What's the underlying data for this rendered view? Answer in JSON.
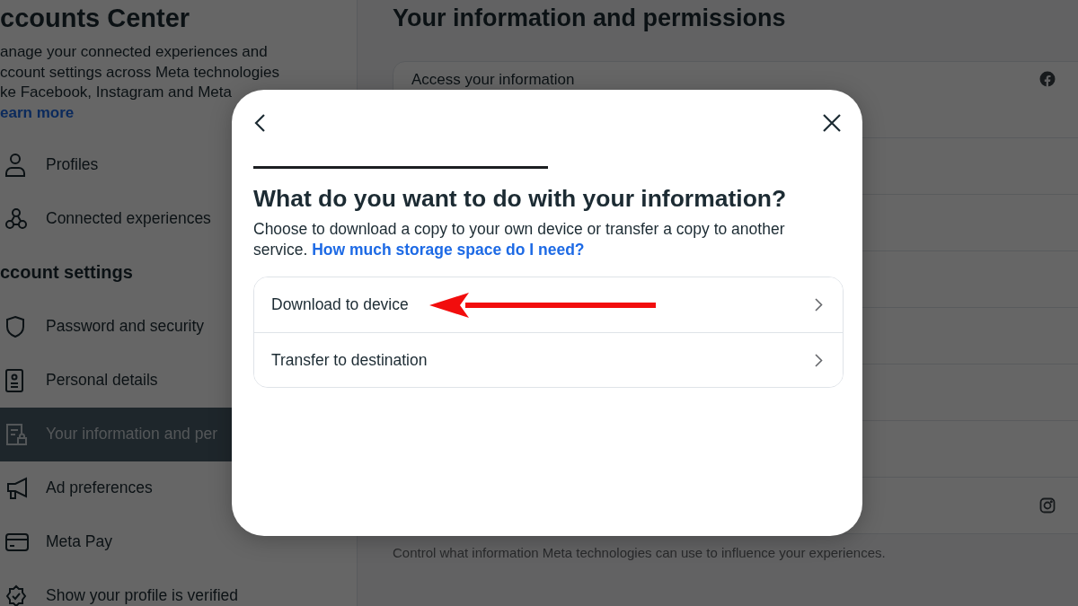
{
  "sidebar": {
    "title": "ccounts Center",
    "description": [
      "anage your connected experiences and",
      "ccount settings across Meta technologies",
      "ke Facebook, Instagram and Meta"
    ],
    "learn_more": "earn more",
    "items": [
      {
        "kind": "item",
        "label": "Profiles",
        "selected": false
      },
      {
        "kind": "item",
        "label": "Connected experiences",
        "selected": false
      },
      {
        "kind": "heading",
        "label": "ccount settings"
      },
      {
        "kind": "item",
        "label": "Password and security",
        "selected": false
      },
      {
        "kind": "item",
        "label": "Personal details",
        "selected": false
      },
      {
        "kind": "item",
        "label": "Your information and per",
        "selected": true
      },
      {
        "kind": "item",
        "label": "Ad preferences",
        "selected": false
      },
      {
        "kind": "item",
        "label": "Meta Pay",
        "selected": false
      },
      {
        "kind": "item",
        "label": "Show your profile is verified",
        "selected": false
      }
    ]
  },
  "main": {
    "title": "Your information and permissions",
    "rows": [
      {
        "kind": "labeled",
        "label": "Access your information"
      },
      {
        "kind": "blank"
      },
      {
        "kind": "blank"
      },
      {
        "kind": "blank"
      },
      {
        "kind": "blank"
      },
      {
        "kind": "blank"
      },
      {
        "kind": "blank"
      },
      {
        "kind": "icon"
      }
    ],
    "footer": "Control what information Meta technologies can use to influence your experiences."
  },
  "modal": {
    "progress": {
      "level": 0.5
    },
    "heading": "What do you want to do with your information?",
    "description": "Choose to download a copy to your own device or transfer a copy to another service.",
    "link": "How much storage space do I need?",
    "options": [
      {
        "label": "Download to device",
        "annotated": true
      },
      {
        "label": "Transfer to destination",
        "annotated": false
      }
    ]
  }
}
